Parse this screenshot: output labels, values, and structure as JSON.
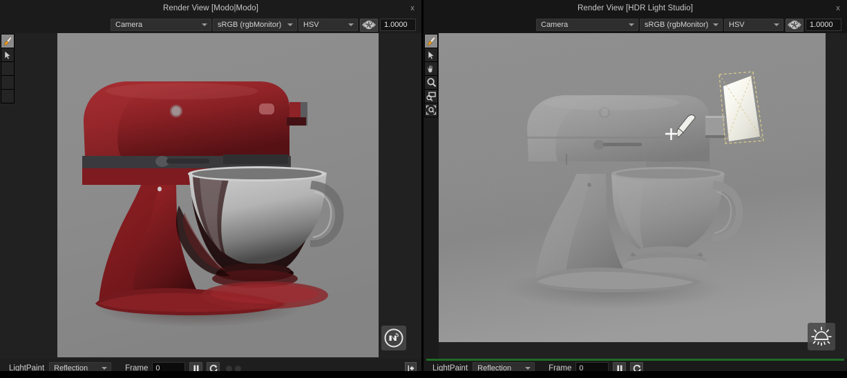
{
  "panels": [
    {
      "id": "modo",
      "title": "Render View [Modo|Modo]",
      "close_label": "x",
      "optbar": {
        "camera": "Camera",
        "colorspace": "sRGB (rgbMonitor)",
        "channel": "HSV",
        "exposure": "1.0000",
        "aperture_icon": "aperture-icon"
      },
      "tools": [
        {
          "name": "lightpaint-brush-tool",
          "icon": "brush-icon",
          "active": true
        },
        {
          "name": "select-arrow-tool",
          "icon": "cursor-arrow-icon",
          "active": false
        },
        {
          "name": "tool-slot-3",
          "icon": "blank-icon",
          "active": false
        },
        {
          "name": "tool-slot-4",
          "icon": "blank-icon",
          "active": false
        },
        {
          "name": "tool-slot-5",
          "icon": "blank-icon",
          "active": false
        }
      ],
      "watermark_icon": "modo-logo-icon",
      "footer": {
        "lightpaint_label": "LightPaint",
        "lightpaint_mode": "Reflection",
        "frame_label": "Frame",
        "frame_value": "0",
        "pause_icon": "pause-icon",
        "refresh_icon": "refresh-loop-icon",
        "dots": 2,
        "collapse_icon": "arrow-left-in-box-icon"
      }
    },
    {
      "id": "hdrls",
      "title": "Render View [HDR Light Studio]",
      "close_label": "x",
      "optbar": {
        "camera": "Camera",
        "colorspace": "sRGB (rgbMonitor)",
        "channel": "HSV",
        "exposure": "1.0000",
        "aperture_icon": "aperture-icon"
      },
      "tools": [
        {
          "name": "lightpaint-brush-tool",
          "icon": "brush-icon",
          "active": true
        },
        {
          "name": "select-arrow-tool",
          "icon": "cursor-arrow-icon",
          "active": false
        },
        {
          "name": "pan-hand-tool",
          "icon": "hand-icon",
          "active": false
        },
        {
          "name": "zoom-magnifier-tool",
          "icon": "magnifier-icon",
          "active": false
        },
        {
          "name": "zoom-region-tool",
          "icon": "zoom-region-icon",
          "active": false
        },
        {
          "name": "zoom-fit-tool",
          "icon": "zoom-fit-icon",
          "active": false
        }
      ],
      "watermark_icon": "hdr-light-studio-sun-icon",
      "footer": {
        "lightpaint_label": "LightPaint",
        "lightpaint_mode": "Reflection",
        "frame_label": "Frame",
        "frame_value": "0",
        "pause_icon": "pause-icon",
        "refresh_icon": "refresh-loop-icon",
        "dots": 0
      }
    }
  ],
  "colors": {
    "window_bg": "#212121",
    "titlebar_bg": "#1b1b1b",
    "render_bg_left": "#8c8c8c",
    "render_bg_right": "#8a8a8a",
    "mixer_red": "#8b1f23",
    "mixer_grey": "#9a9a9a",
    "active_panel_accent": "#1f6b26",
    "light_gizmo_outline": "#d8c98a",
    "light_card": "#fdfdf4"
  },
  "scene": {
    "subject": "KitchenAid stand mixer",
    "left_view_description": "Dark red glossy stand mixer with chrome bowl on flat grey backdrop",
    "right_view_description": "Grey clay-shaded stand mixer on grey backdrop with an area light card gizmo at upper right and a LightPaint brush cursor on the motor housing"
  }
}
